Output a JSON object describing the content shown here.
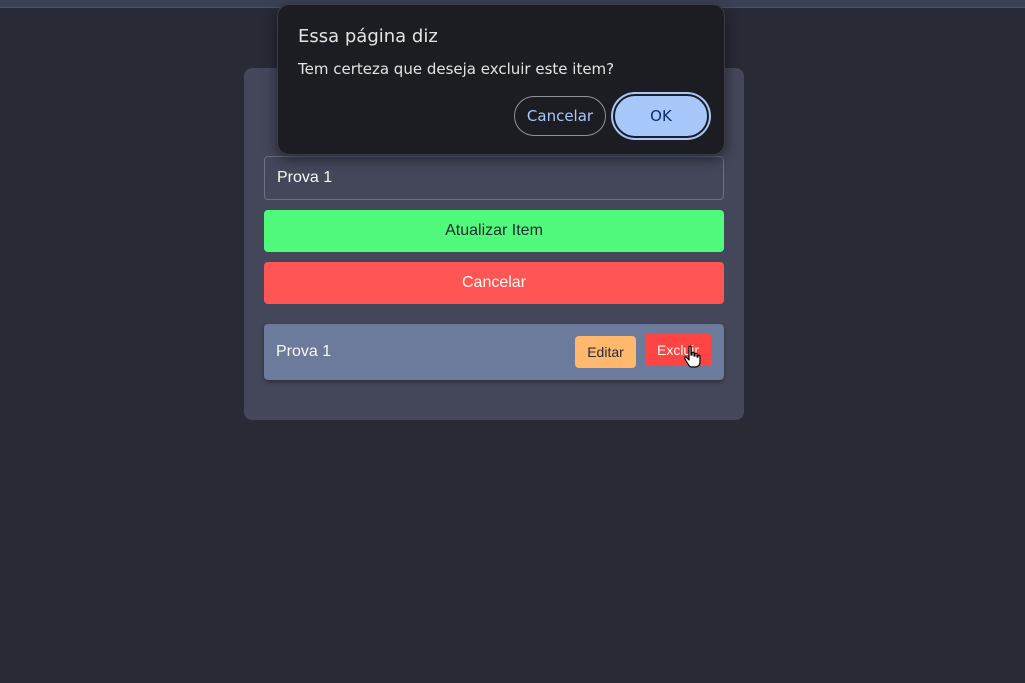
{
  "form": {
    "input_value": "Prova 1",
    "update_button": "Atualizar Item",
    "cancel_button": "Cancelar"
  },
  "list": {
    "items": [
      {
        "label": "Prova 1",
        "edit_label": "Editar",
        "delete_label": "Excluir"
      }
    ]
  },
  "dialog": {
    "title": "Essa página diz",
    "message": "Tem certeza que deseja excluir este item?",
    "cancel_label": "Cancelar",
    "ok_label": "OK"
  },
  "cursor": {
    "icon": "hand-pointer-icon"
  },
  "colors": {
    "background": "#282a36",
    "card": "#44475a",
    "update": "#50fa7b",
    "cancel": "#ff5555",
    "list_item": "#6c7a9c",
    "edit": "#ffb86c",
    "delete": "#ff4444",
    "dialog_bg": "#1b1d22",
    "dialog_accent": "#a8c7fa"
  }
}
